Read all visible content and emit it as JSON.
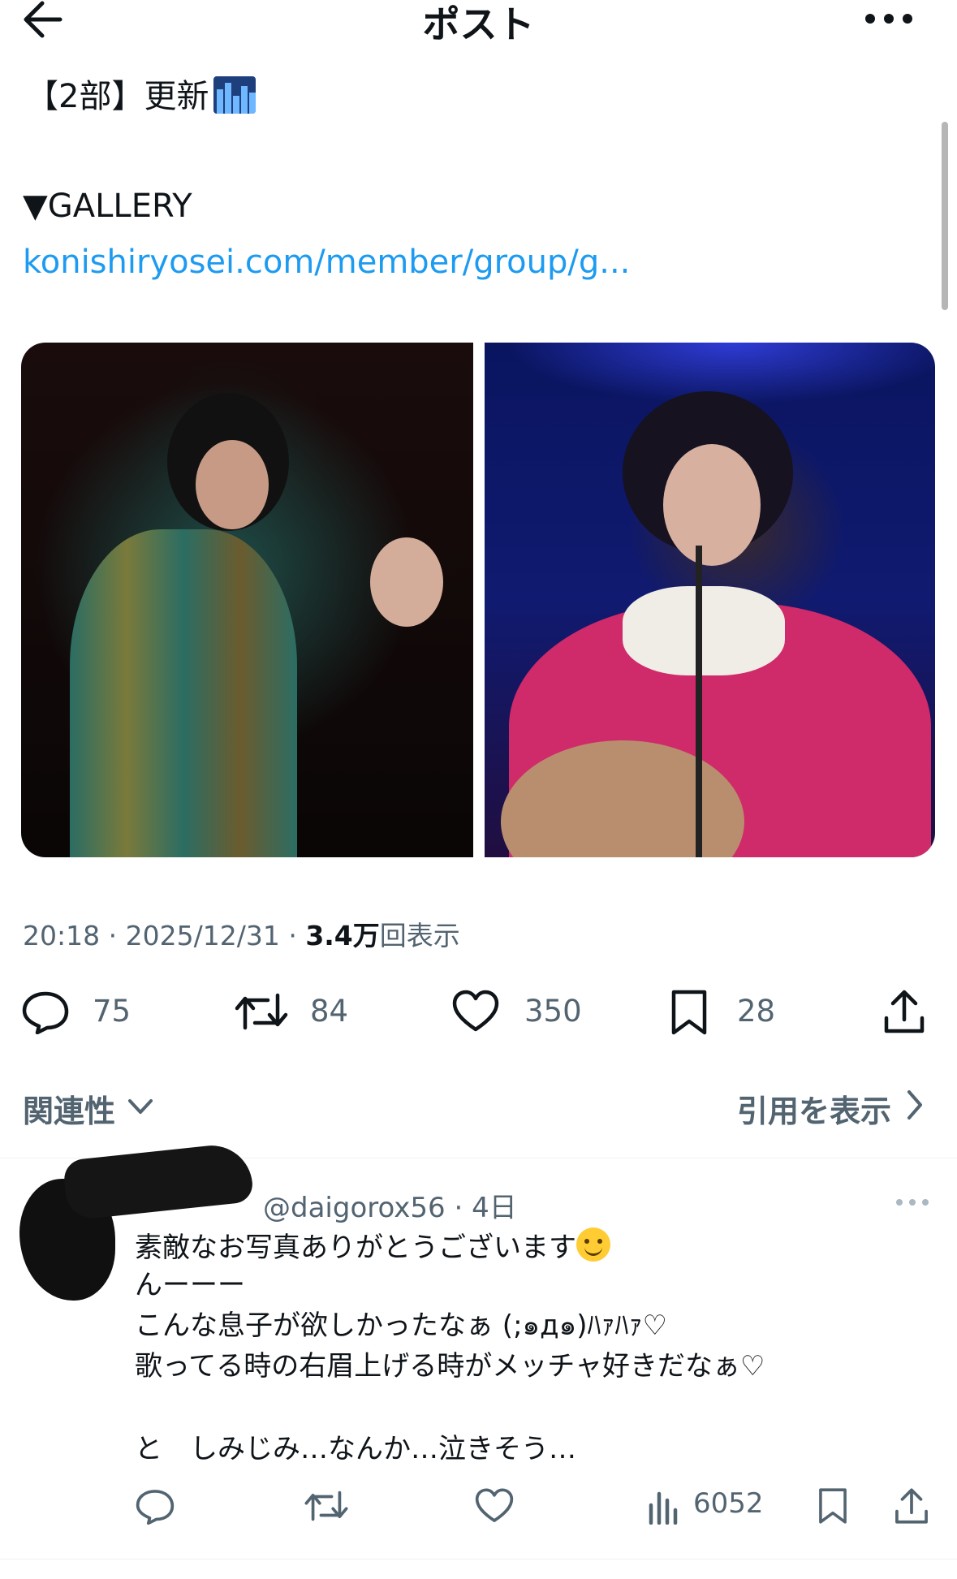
{
  "header": {
    "title": "ポスト",
    "back_icon": "arrow-left-icon",
    "more_icon": "ellipsis-icon"
  },
  "post": {
    "line1": "【2部】更新",
    "line1_emoji": "cityscape-emoji",
    "line2": "▼GALLERY",
    "link": "konishiryosei.com/member/group/g...",
    "link_color": "#1d9bf0",
    "time": "20:18",
    "date": "2025/12/31",
    "views_value": "3.4",
    "views_unit": "万",
    "views_suffix": "回表示",
    "separator": "·"
  },
  "actions": {
    "reply_count": "75",
    "repost_count": "84",
    "like_count": "350",
    "bookmark_count": "28"
  },
  "filters": {
    "relevance_label": "関連性",
    "quotes_label": "引用を表示"
  },
  "reply": {
    "handle": "@daigorox56",
    "age": "4日",
    "lines": [
      "素敵なお写真ありがとうございます",
      "んーーー",
      "こんな息子が欲しかったなぁ (;๑д๑)ﾊｧﾊｧ♡",
      "歌ってる時の右眉上げる時がメッチャ好きだなぁ♡",
      "と　しみじみ…なんか…泣きそう…"
    ],
    "views": "6052"
  },
  "colors": {
    "text": "#0f1419",
    "secondary": "#536471",
    "divider": "#eff3f4"
  }
}
